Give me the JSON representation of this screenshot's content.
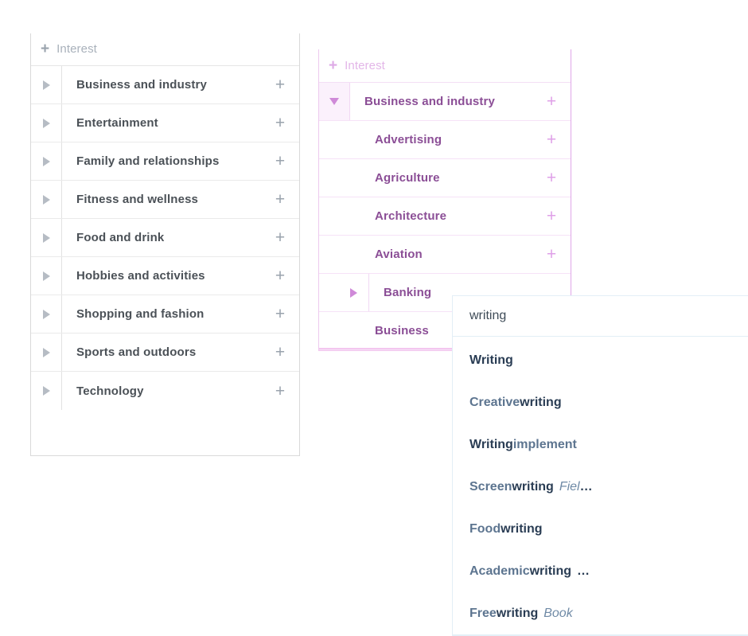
{
  "root_panel": {
    "header": {
      "plus": "+",
      "label": "Interest"
    },
    "rows": [
      {
        "label": "Business and industry",
        "plus": "+",
        "caret": "right"
      },
      {
        "label": "Entertainment",
        "plus": "+",
        "caret": "right"
      },
      {
        "label": "Family and relationships",
        "plus": "+",
        "caret": "right"
      },
      {
        "label": "Fitness and wellness",
        "plus": "+",
        "caret": "right"
      },
      {
        "label": "Food and drink",
        "plus": "+",
        "caret": "right"
      },
      {
        "label": "Hobbies and activities",
        "plus": "+",
        "caret": "right"
      },
      {
        "label": "Shopping and fashion",
        "plus": "+",
        "caret": "right"
      },
      {
        "label": "Sports and outdoors",
        "plus": "+",
        "caret": "right"
      },
      {
        "label": "Technology",
        "plus": "+",
        "caret": "right"
      }
    ]
  },
  "expanded_panel": {
    "header": {
      "plus": "+",
      "label": "Interest"
    },
    "rows": [
      {
        "label": "Business and industry",
        "plus": "+",
        "caret": "down",
        "level": 0
      },
      {
        "label": "Advertising",
        "plus": "+",
        "caret": "none",
        "level": 1
      },
      {
        "label": "Agriculture",
        "plus": "+",
        "caret": "none",
        "level": 1
      },
      {
        "label": "Architecture",
        "plus": "+",
        "caret": "none",
        "level": 1
      },
      {
        "label": "Aviation",
        "plus": "+",
        "caret": "none",
        "level": 1
      },
      {
        "label": "Banking",
        "plus": "",
        "caret": "right",
        "level": 1
      },
      {
        "label": "Business",
        "plus": "",
        "caret": "none",
        "level": 1
      }
    ]
  },
  "autocomplete": {
    "query": "writing",
    "placeholder": "",
    "items": [
      {
        "before": "",
        "match": "Writing",
        "after": "",
        "extra": "",
        "ellipsis": ""
      },
      {
        "before": "Creative ",
        "match": "writing",
        "after": "",
        "extra": "",
        "ellipsis": ""
      },
      {
        "before": "",
        "match": "Writing",
        "after": " implement",
        "extra": "",
        "ellipsis": ""
      },
      {
        "before": "Screen",
        "match": "writing",
        "after": "",
        "extra": "Fiel",
        "ellipsis": "…"
      },
      {
        "before": "Food ",
        "match": "writing",
        "after": "",
        "extra": "",
        "ellipsis": ""
      },
      {
        "before": "Academic ",
        "match": "writing",
        "after": "",
        "extra": "",
        "ellipsis": " …"
      },
      {
        "before": "Free ",
        "match": "writing",
        "after": "",
        "extra": "Book",
        "ellipsis": ""
      }
    ]
  },
  "colors": {
    "grey_panel_border": "#d9d9d9",
    "grey_text": "#4b5157",
    "grey_muted": "#a9b1bb",
    "purple_text": "#8b4e96",
    "purple_accent": "#dfa0e8",
    "purple_border": "#f6e2f7",
    "dropdown_match": "#2a3d54",
    "dropdown_plain": "#5d7590",
    "dropdown_border": "#e3eef6"
  }
}
